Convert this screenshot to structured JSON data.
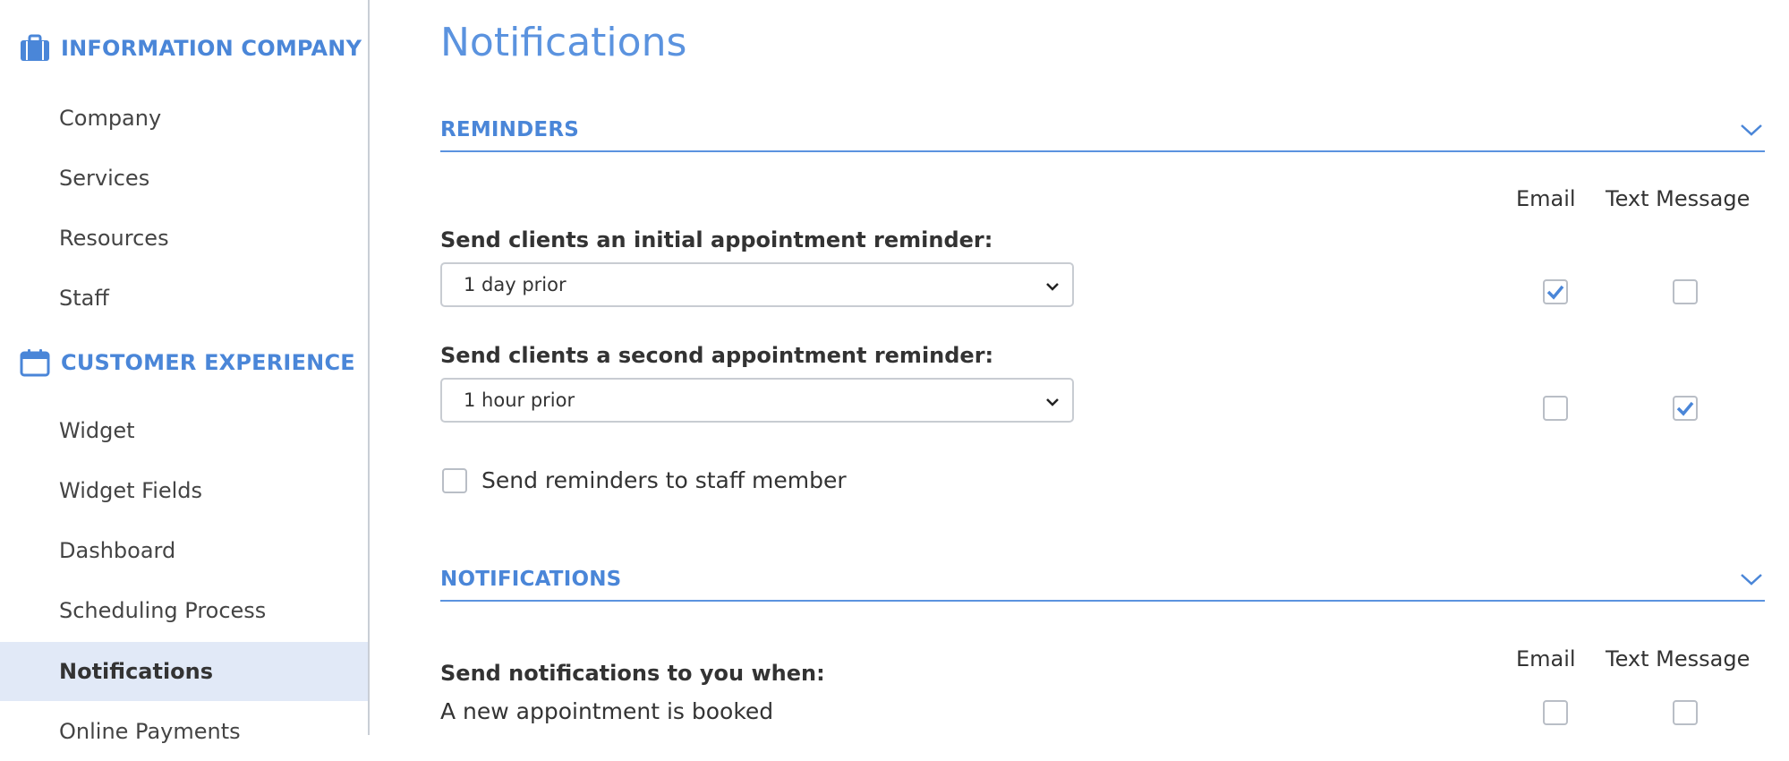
{
  "sidebar": {
    "sections": [
      {
        "title": "INFORMATION COMPANY",
        "icon": "briefcase-icon",
        "items": [
          "Company",
          "Services",
          "Resources",
          "Staff"
        ]
      },
      {
        "title": "CUSTOMER EXPERIENCE",
        "icon": "calendar-icon",
        "items": [
          "Widget",
          "Widget Fields",
          "Dashboard",
          "Scheduling Process",
          "Notifications",
          "Online Payments"
        ]
      }
    ],
    "active_item": "Notifications"
  },
  "main": {
    "title": "Notifications",
    "reminders": {
      "title": "REMINDERS",
      "col_email": "Email",
      "col_text": "Text Message",
      "initial": {
        "label": "Send clients an initial appointment reminder:",
        "value": "1 day prior",
        "email_checked": true,
        "text_checked": false
      },
      "second": {
        "label": "Send clients a second appointment reminder:",
        "value": "1 hour prior",
        "email_checked": false,
        "text_checked": true
      },
      "staff_option": {
        "label": "Send reminders to staff member",
        "checked": false
      }
    },
    "notifications": {
      "title": "NOTIFICATIONS",
      "col_email": "Email",
      "col_text": "Text Message",
      "heading": "Send notifications to you when:",
      "rows": [
        {
          "label": "A new appointment is booked",
          "email_checked": false,
          "text_checked": false
        }
      ]
    }
  },
  "colors": {
    "accent": "#4a86d8",
    "active_bg": "#e1e9f7",
    "border": "#c8ccd2"
  }
}
